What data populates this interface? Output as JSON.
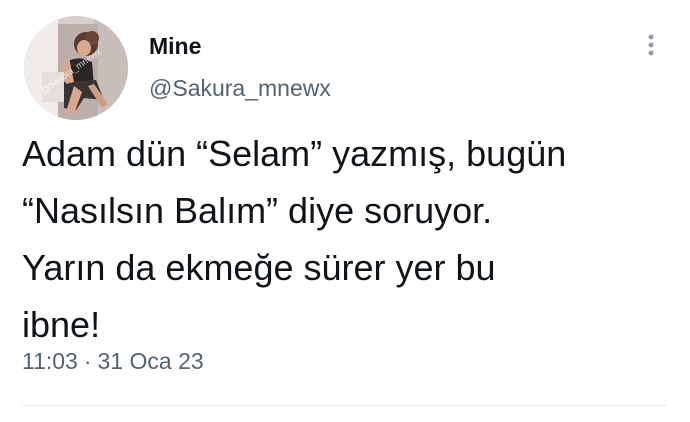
{
  "author": {
    "display_name": "Mine",
    "handle": "@Sakura_mnewx",
    "avatar_watermark": "@Sakura_mnewx"
  },
  "more_icon": "more-vertical-icon",
  "tweet": {
    "text": "Adam dün “Selam” yazmış, bugün\n“Nasılsın Balım” diye soruyor.\nYarın da ekmeğe sürer yer bu\nibne!",
    "time": "11:03",
    "separator": "·",
    "date": "31 Oca 23"
  },
  "colors": {
    "text_primary": "#0f1419",
    "text_secondary": "#536471",
    "divider": "#e6ebee",
    "background": "#ffffff"
  }
}
